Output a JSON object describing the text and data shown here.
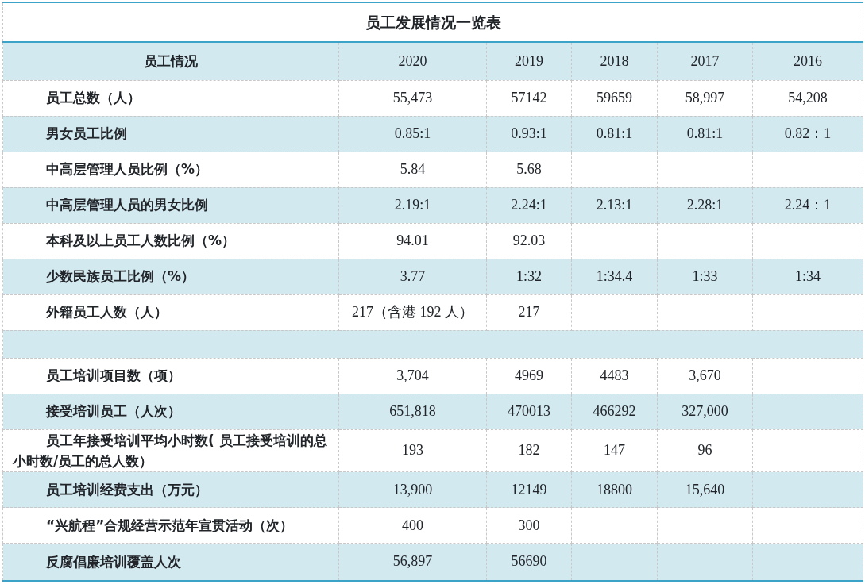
{
  "title": "员工发展情况一览表",
  "columns": [
    "员工情况",
    "2020",
    "2019",
    "2018",
    "2017",
    "2016"
  ],
  "rows": [
    {
      "kind": "data",
      "label": "员工总数（人）",
      "values": [
        "55,473",
        "57142",
        "59659",
        "58,997",
        "54,208"
      ]
    },
    {
      "kind": "data",
      "label": "男女员工比例",
      "values": [
        "0.85:1",
        "0.93:1",
        "0.81:1",
        "0.81:1",
        "0.82：1"
      ]
    },
    {
      "kind": "data",
      "label": "中高层管理人员比例（%）",
      "values": [
        "5.84",
        "5.68"
      ]
    },
    {
      "kind": "data",
      "label": "中高层管理人员的男女比例",
      "values": [
        "2.19:1",
        "2.24:1",
        "2.13:1",
        "2.28:1",
        "2.24：1"
      ]
    },
    {
      "kind": "data",
      "label": "本科及以上员工人数比例（%）",
      "values": [
        "94.01",
        "92.03"
      ]
    },
    {
      "kind": "data",
      "label": "少数民族员工比例（%）",
      "values": [
        "3.77",
        "1:32",
        "1:34.4",
        "1:33",
        "1:34"
      ]
    },
    {
      "kind": "data",
      "label": "外籍员工人数（人）",
      "values": [
        "217（含港 192 人）",
        "217"
      ]
    },
    {
      "kind": "spacer"
    },
    {
      "kind": "data",
      "label": "员工培训项目数（项）",
      "values": [
        "3,704",
        "4969",
        "4483",
        "3,670"
      ]
    },
    {
      "kind": "data",
      "label": "接受培训员工（人次）",
      "values": [
        "651,818",
        "470013",
        "466292",
        "327,000"
      ]
    },
    {
      "kind": "data",
      "label": "员工年接受培训平均小时数( 员工接受培训的总小时数/员工的总人数）",
      "values": [
        "193",
        "182",
        "147",
        "96"
      ]
    },
    {
      "kind": "data",
      "label": "员工培训经费支出（万元）",
      "values": [
        "13,900",
        "12149",
        "18800",
        "15,640"
      ]
    },
    {
      "kind": "data",
      "label": "“兴航程”合规经营示范年宣贯活动（次）",
      "values": [
        "400",
        "300"
      ]
    },
    {
      "kind": "data",
      "label": "反腐倡廉培训覆盖人次",
      "values": [
        "56,897",
        "56690"
      ]
    }
  ]
}
